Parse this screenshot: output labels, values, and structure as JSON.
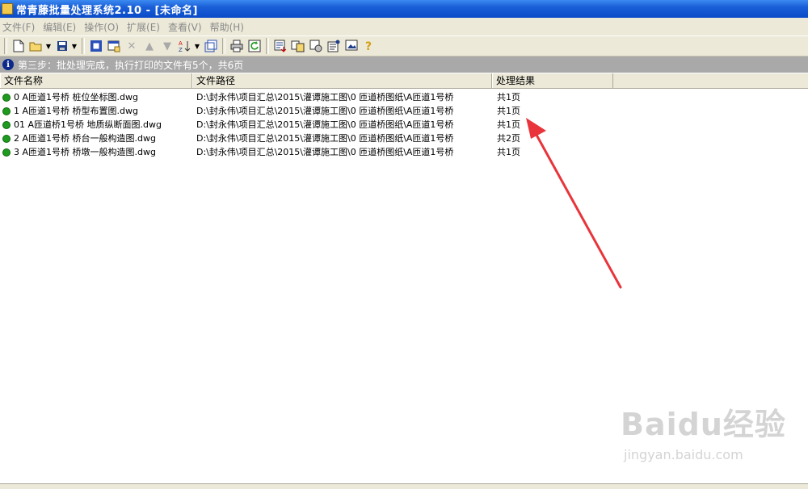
{
  "window": {
    "title": "常青藤批量处理系统2.10 - [未命名]"
  },
  "menu": [
    "文件(F)",
    "编辑(E)",
    "操作(O)",
    "扩展(E)",
    "查看(V)",
    "帮助(H)"
  ],
  "status_message": "第三步：批处理完成，执行打印的文件有5个，共6页",
  "columns": {
    "name": "文件名称",
    "path": "文件路径",
    "result": "处理结果"
  },
  "rows": [
    {
      "name": "0 A匝道1号桥 桩位坐标图.dwg",
      "path": "D:\\封永伟\\项目汇总\\2015\\灌谭施工图\\0 匝道桥图纸\\A匝道1号桥",
      "result": "共1页"
    },
    {
      "name": "1 A匝道1号桥 桥型布置图.dwg",
      "path": "D:\\封永伟\\项目汇总\\2015\\灌谭施工图\\0 匝道桥图纸\\A匝道1号桥",
      "result": "共1页"
    },
    {
      "name": "01 A匝道桥1号桥 地质纵断面图.dwg",
      "path": "D:\\封永伟\\项目汇总\\2015\\灌谭施工图\\0 匝道桥图纸\\A匝道1号桥",
      "result": "共1页"
    },
    {
      "name": "2 A匝道1号桥 桥台一般构造图.dwg",
      "path": "D:\\封永伟\\项目汇总\\2015\\灌谭施工图\\0 匝道桥图纸\\A匝道1号桥",
      "result": "共2页"
    },
    {
      "name": "3 A匝道1号桥 桥墩一般构造图.dwg",
      "path": "D:\\封永伟\\项目汇总\\2015\\灌谭施工图\\0 匝道桥图纸\\A匝道1号桥",
      "result": "共1页"
    }
  ],
  "watermark": {
    "brand": "Baidu经验",
    "url": "jingyan.baidu.com"
  },
  "colors": {
    "title_bar": "#0a4bc8",
    "status_dot": "#1e9a1e",
    "arrow": "#e8343a",
    "status_line": "#a9a9a9"
  }
}
